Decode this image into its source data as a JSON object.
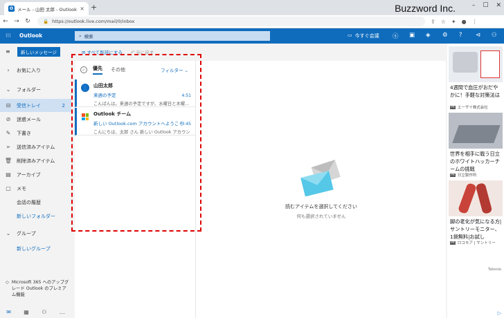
{
  "browser": {
    "tab_title": "メール - 山田 太郎 - Outlook",
    "url": "https://outlook.live.com/mail/0/inbox",
    "brand": "Buzzword Inc."
  },
  "suite": {
    "app_name": "Outlook",
    "search_placeholder": "検索",
    "meet_now": "今すぐ会議"
  },
  "nav": {
    "new_message": "新しいメッセージ",
    "items": [
      {
        "label": "お気に入り",
        "icon": "chevron-right-icon"
      },
      {
        "label": "フォルダー",
        "icon": "chevron-down-icon"
      },
      {
        "label": "受信トレイ",
        "icon": "inbox-icon",
        "count": "2",
        "selected": true
      },
      {
        "label": "迷惑メール",
        "icon": "blocked-icon"
      },
      {
        "label": "下書き",
        "icon": "pencil-icon"
      },
      {
        "label": "送信済みアイテム",
        "icon": "send-icon"
      },
      {
        "label": "削除済みアイテム",
        "icon": "trash-icon"
      },
      {
        "label": "アーカイブ",
        "icon": "archive-icon"
      },
      {
        "label": "メモ",
        "icon": "note-icon"
      },
      {
        "label": "会話の履歴",
        "icon": ""
      },
      {
        "label": "新しいフォルダー",
        "icon": "",
        "link": true
      },
      {
        "label": "グループ",
        "icon": "chevron-down-icon"
      },
      {
        "label": "新しいグループ",
        "icon": "",
        "link": true
      }
    ],
    "upgrade_text": "Microsoft 365 へのアップグレード Outlook のプレミアム機能"
  },
  "commands": {
    "mark_all_read": "すべて既読にする",
    "undo": "元に戻す"
  },
  "list": {
    "tab_focused": "優先",
    "tab_other": "その他",
    "filter": "フィルター",
    "messages": [
      {
        "from": "山田太郎",
        "subject": "来週の予定",
        "preview": "こんばんは。来週の予定ですが、水曜日と木曜...",
        "time": "4:51"
      },
      {
        "from": "Outlook チーム",
        "subject": "新しい Outlook.com アカウントへようこそ",
        "preview": "こんにちは、太郎 さん 新しい Outlook アカウント...",
        "time": "3:45"
      }
    ]
  },
  "reading": {
    "title": "読むアイテムを選択してください",
    "subtitle": "何も選択されていません"
  },
  "ads": [
    {
      "text": "4週間で血圧がおだやかに！手軽な対策法は",
      "source": "エーザイ株式会社"
    },
    {
      "text": "世界を相手に戦う日立のホワイトハッカーチームの挑戦",
      "source": "日立製作所"
    },
    {
      "text": "脚の老化が気になる方|サントリーモニター、1袋無料|お試し",
      "source": "ロコモア | サントリー"
    }
  ],
  "taboola": "Taboola"
}
